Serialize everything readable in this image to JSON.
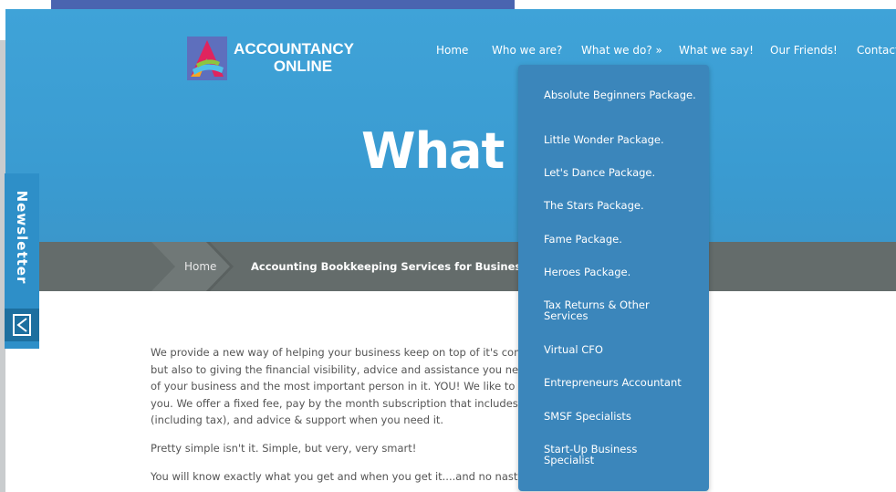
{
  "logo": {
    "line1": "ACCOUNTANCY",
    "line2": "ONLINE"
  },
  "nav": {
    "items": [
      {
        "label": "Home"
      },
      {
        "label": "Who we are?"
      },
      {
        "label": "What we do? »"
      },
      {
        "label": "What we say!"
      },
      {
        "label": "Our Friends!"
      },
      {
        "label": "Contact"
      }
    ]
  },
  "hero": {
    "title": "What"
  },
  "breadcrumb": {
    "home": "Home",
    "current": "Accounting Bookkeeping Services for Business"
  },
  "newsletter": {
    "label": "Newsletter",
    "icon": "newsletter-arrow-icon"
  },
  "dropdown": {
    "items": [
      {
        "label": "Absolute Beginners Package."
      },
      {
        "label": "Little Wonder Package."
      },
      {
        "label": "Let's Dance Package."
      },
      {
        "label": "The Stars Package."
      },
      {
        "label": "Fame Package."
      },
      {
        "label": "Heroes Package."
      },
      {
        "label": "Tax Returns & Other Services"
      },
      {
        "label": "Virtual CFO"
      },
      {
        "label": "Entrepreneurs Accountant"
      },
      {
        "label": "SMSF Specialists"
      },
      {
        "label": "Start-Up Business Specialist"
      }
    ]
  },
  "content": {
    "lines": [
      "We provide a new way of helping your business keep on top of it's comp",
      "but also to giving the financial visibility, advice and assistance you need",
      "of your business and the most important person in it. YOU! We like to k",
      "you. We offer a fixed fee, pay by the month subscription that includes a",
      "(including tax), and advice & support when you need it."
    ],
    "para2": "Pretty simple isn't it. Simple, but very, very smart!",
    "para3": "You will know exactly what you get and when you get it....and no nasty s"
  },
  "colors": {
    "hero_blue": "#3fa3d8",
    "breadcrumb_gray": "#646c6b",
    "dropdown_blue": "#3b86bb",
    "newsletter_blue": "#2e8fc8"
  }
}
